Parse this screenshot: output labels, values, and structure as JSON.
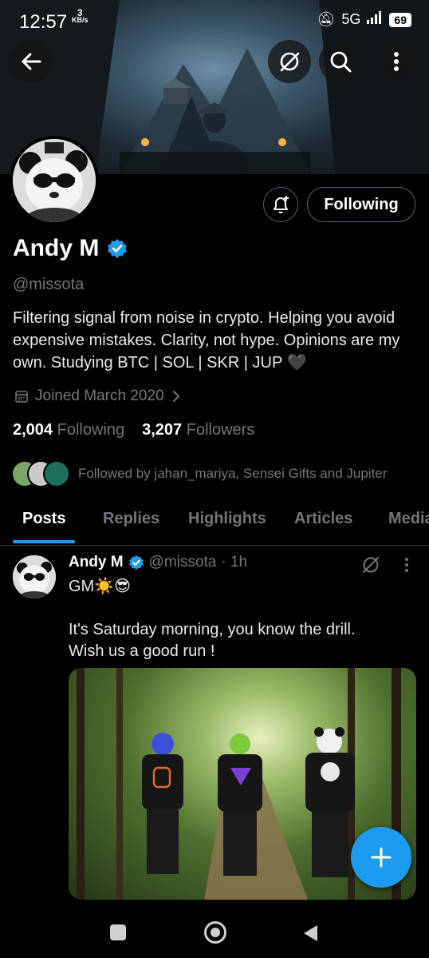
{
  "status_bar": {
    "time": "12:57",
    "speed_value": "3",
    "speed_unit": "KB/s",
    "network": "5G",
    "battery": "69"
  },
  "profile": {
    "name": "Andy M",
    "handle": "@missota",
    "bio": "Filtering signal from noise in crypto. Helping you avoid expensive mistakes. Clarity, not hype. Opinions are my own.  Studying BTC | SOL | SKR |  JUP 🖤",
    "joined": "Joined March 2020",
    "following_count": "2,004",
    "following_label": "Following",
    "followers_count": "3,207",
    "followers_label": "Followers",
    "followed_by": "Followed by jahan_mariya, Sensei Gifts and Jupiter",
    "follow_button": "Following"
  },
  "tabs": [
    "Posts",
    "Replies",
    "Highlights",
    "Articles",
    "Media"
  ],
  "post": {
    "name": "Andy M",
    "handle": "@missota",
    "time": "· 1h",
    "line1": "GM☀️😎",
    "line2": "It's Saturday morning, you know the drill.",
    "line3": "Wish us a good run !"
  },
  "colors": {
    "accent": "#1d9bf0",
    "muted": "#71767b",
    "border": "#536471"
  }
}
